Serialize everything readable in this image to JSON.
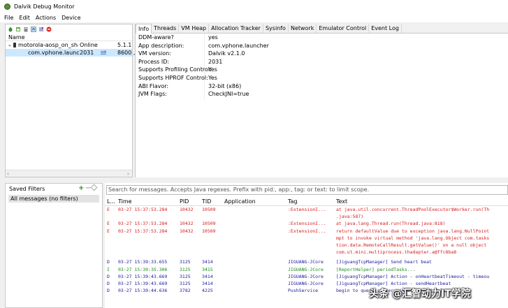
{
  "window": {
    "title": "Dalvik Debug Monitor"
  },
  "menu": [
    "File",
    "Edit",
    "Actions",
    "Device"
  ],
  "devices": {
    "column_name": "Name",
    "device": {
      "name": "motorola-aosp_on_sha",
      "status": "Online",
      "version": "5.1.1"
    },
    "process": {
      "name": "com.vphone.launche",
      "pid": "2031",
      "port": "8600 ,"
    }
  },
  "tabs": [
    "Info",
    "Threads",
    "VM Heap",
    "Allocation Tracker",
    "Sysinfo",
    "Network",
    "Emulator Control",
    "Event Log"
  ],
  "info": [
    {
      "k": "DDM-aware?",
      "v": "yes"
    },
    {
      "k": "App description:",
      "v": "com.vphone.launcher"
    },
    {
      "k": "VM version:",
      "v": "Dalvik v2.1.0"
    },
    {
      "k": "Process ID:",
      "v": "2031"
    },
    {
      "k": "Supports Profiling Control:",
      "v": "Yes"
    },
    {
      "k": "Supports HPROF Control:",
      "v": "Yes"
    },
    {
      "k": "ABI Flavor:",
      "v": "32-bit (x86)"
    },
    {
      "k": "JVM Flags:",
      "v": "CheckJNI=true"
    }
  ],
  "filters": {
    "title": "Saved Filters",
    "items": [
      "All messages (no filters)"
    ]
  },
  "log": {
    "search_placeholder": "Search for messages. Accepts Java regexes. Prefix with pid:, app:, tag: or text: to limit scope.",
    "columns": [
      "L...",
      "Time",
      "PID",
      "TID",
      "Application",
      "Tag",
      "Text"
    ],
    "rows": [
      {
        "l": "E",
        "time": "03-27 15:37:53.284",
        "pid": "10432",
        "tid": "10509",
        "app": "",
        "tag": ":ExtensionI...",
        "text": "at java.util.concurrent.ThreadPoolExecutor$Worker.run(Th",
        "color": "#d8191c"
      },
      {
        "l": "",
        "time": "",
        "pid": "",
        "tid": "",
        "app": "",
        "tag": "",
        "text": ".java:587)",
        "color": "#d8191c"
      },
      {
        "l": "E",
        "time": "03-27 15:37:53.284",
        "pid": "10432",
        "tid": "10509",
        "app": "",
        "tag": ":ExtensionI...",
        "text": "at java.lang.Thread.run(Thread.java:818)",
        "color": "#d8191c"
      },
      {
        "l": "E",
        "time": "03-27 15:37:53.284",
        "pid": "10432",
        "tid": "10509",
        "app": "",
        "tag": ":ExtensionI...",
        "text": "return defaultValue due to exception java.lang.NullPoint",
        "color": "#d8191c"
      },
      {
        "l": "",
        "time": "",
        "pid": "",
        "tid": "",
        "app": "",
        "tag": "",
        "text": "mpt to invoke virtual method 'java.lang.Object com.tasks",
        "color": "#d8191c"
      },
      {
        "l": "",
        "time": "",
        "pid": "",
        "tid": "",
        "app": "",
        "tag": "",
        "text": "tion.data.RemoteCallResult.getValue()' on a null object",
        "color": "#d8191c"
      },
      {
        "l": "",
        "time": "",
        "pid": "",
        "tid": "",
        "app": "",
        "tag": "",
        "text": "com.ut.mini.multiprocess.thadapter.a@ffc8ba8",
        "color": "#d8191c"
      },
      {
        "l": "D",
        "time": "03-27 15:39:33.655",
        "pid": "3125",
        "tid": "3414",
        "app": "",
        "tag": "JIGUANG-JCore",
        "text": "[JiguangTcpManager] Send heart beat",
        "color": "#1a1a9c"
      },
      {
        "l": "I",
        "time": "03-27 15:39:35.306",
        "pid": "3125",
        "tid": "3415",
        "app": "",
        "tag": "JIGUANG-JCore",
        "text": "[ReportHelper] periodTasks...",
        "color": "#1b8a1b"
      },
      {
        "l": "D",
        "time": "03-27 15:39:43.669",
        "pid": "3125",
        "tid": "3414",
        "app": "",
        "tag": "JIGUANG-JCore",
        "text": "[JiguangTcpManager] Action - onHeartbeatTimeout - timeou",
        "color": "#1a1a9c"
      },
      {
        "l": "D",
        "time": "03-27 15:39:43.669",
        "pid": "3125",
        "tid": "3414",
        "app": "",
        "tag": "JIGUANG-JCore",
        "text": "[JiguangTcpManager] Action - sendHeartbeat",
        "color": "#1a1a9c"
      },
      {
        "l": "D",
        "time": "03-27 15:39:44.636",
        "pid": "3782",
        "tid": "4225",
        "app": "",
        "tag": "PushService",
        "text": "begin to query server, isBackground=false",
        "color": "#1a1a9c"
      }
    ]
  },
  "watermark": "头条 @汇智动力IT学院"
}
